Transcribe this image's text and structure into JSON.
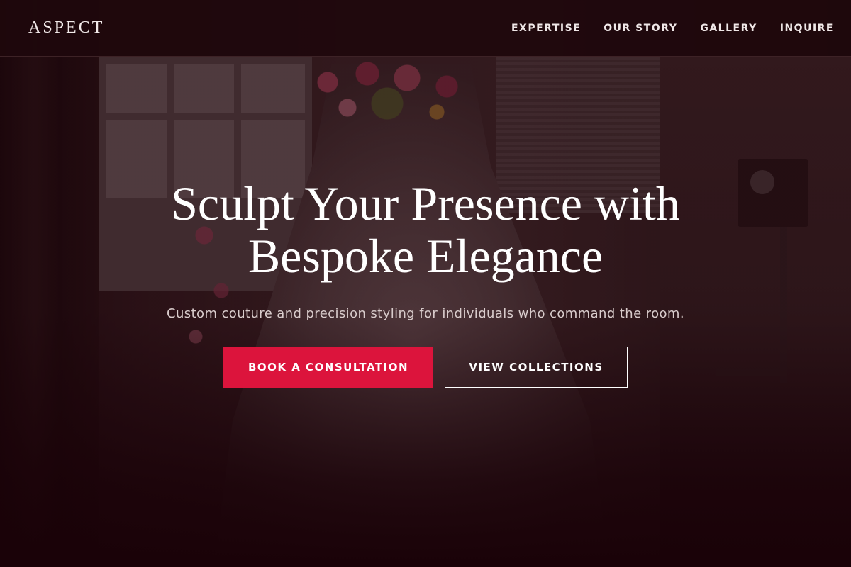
{
  "brand": {
    "logo": "ASPECT"
  },
  "nav": {
    "items": [
      {
        "label": "EXPERTISE"
      },
      {
        "label": "OUR STORY"
      },
      {
        "label": "GALLERY"
      },
      {
        "label": "INQUIRE"
      }
    ]
  },
  "hero": {
    "headline_line1": "Sculpt Your Presence with",
    "headline_line2": "Bespoke Elegance",
    "subheadline": "Custom couture and precision styling for individuals who command the room.",
    "primary_cta": "BOOK A CONSULTATION",
    "secondary_cta": "VIEW COLLECTIONS"
  },
  "colors": {
    "accent": "#dc143c",
    "background": "#1a0408",
    "header_bg": "#1e080c",
    "text_light": "#ffffff"
  }
}
